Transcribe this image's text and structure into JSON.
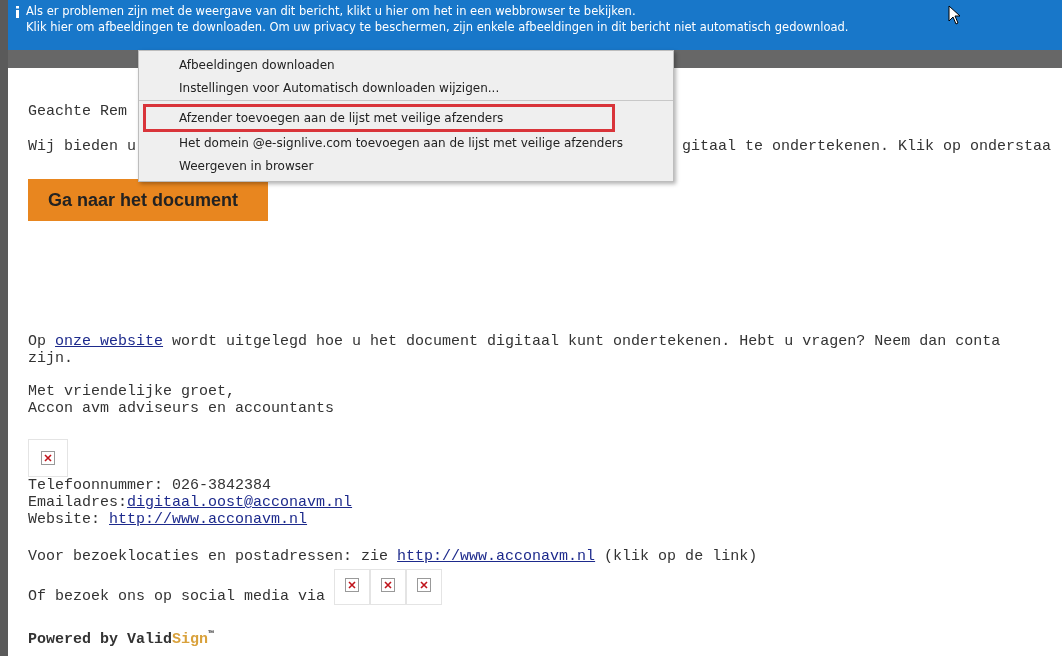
{
  "infobar": {
    "lines": [
      "Als er problemen zijn met de weergave van dit bericht, klikt u hier om het in een webbrowser te bekijken.",
      "Klik hier om afbeeldingen te downloaden. Om uw privacy te beschermen, zijn enkele afbeeldingen in dit bericht niet automatisch gedownload."
    ]
  },
  "context_menu": {
    "items": [
      {
        "label": "Afbeeldingen downloaden",
        "highlighted": false,
        "separator_after": false
      },
      {
        "label": "Instellingen voor Automatisch downloaden wijzigen...",
        "highlighted": false,
        "separator_after": true
      },
      {
        "label": "Afzender toevoegen aan de lijst met veilige afzenders",
        "highlighted": true,
        "separator_after": false
      },
      {
        "label": "Het domein @e-signlive.com toevoegen aan de lijst met veilige afzenders",
        "highlighted": false,
        "separator_after": false
      },
      {
        "label": "Weergeven in browser",
        "highlighted": false,
        "separator_after": false
      }
    ]
  },
  "message": {
    "greeting": "Geachte Rem",
    "intro": {
      "left": "Wij bieden u",
      "right": "gitaal te ondertekenen. Klik op onderstaa"
    },
    "cta_button": "Ga naar het document",
    "info_paragraph": {
      "before": "Op ",
      "link": "onze website",
      "after": " wordt uitgelegd hoe u het document digitaal kunt ondertekenen. Hebt u vragen? Neem dan conta",
      "continuation": "zijn."
    },
    "closing": [
      "Met vriendelijke groet,",
      "Accon avm adviseurs en accountants"
    ],
    "contacts": [
      {
        "label": "Telefoonnummer: ",
        "value": "026-3842384",
        "link": false
      },
      {
        "label": "Emailadres:",
        "value": "digitaal.oost@acconavm.nl",
        "link": true
      },
      {
        "label": "Website: ",
        "value": "http://www.acconavm.nl",
        "link": true
      }
    ],
    "visit": {
      "before": "Voor bezoeklocaties en postadressen: zie ",
      "link": "http://www.acconavm.nl",
      "after": " (klik op de link)"
    },
    "social": {
      "text": "Of bezoek ons op social media via "
    },
    "powered": {
      "prefix": "Powered by Valid",
      "brand": "Sign",
      "mark": "™"
    }
  }
}
